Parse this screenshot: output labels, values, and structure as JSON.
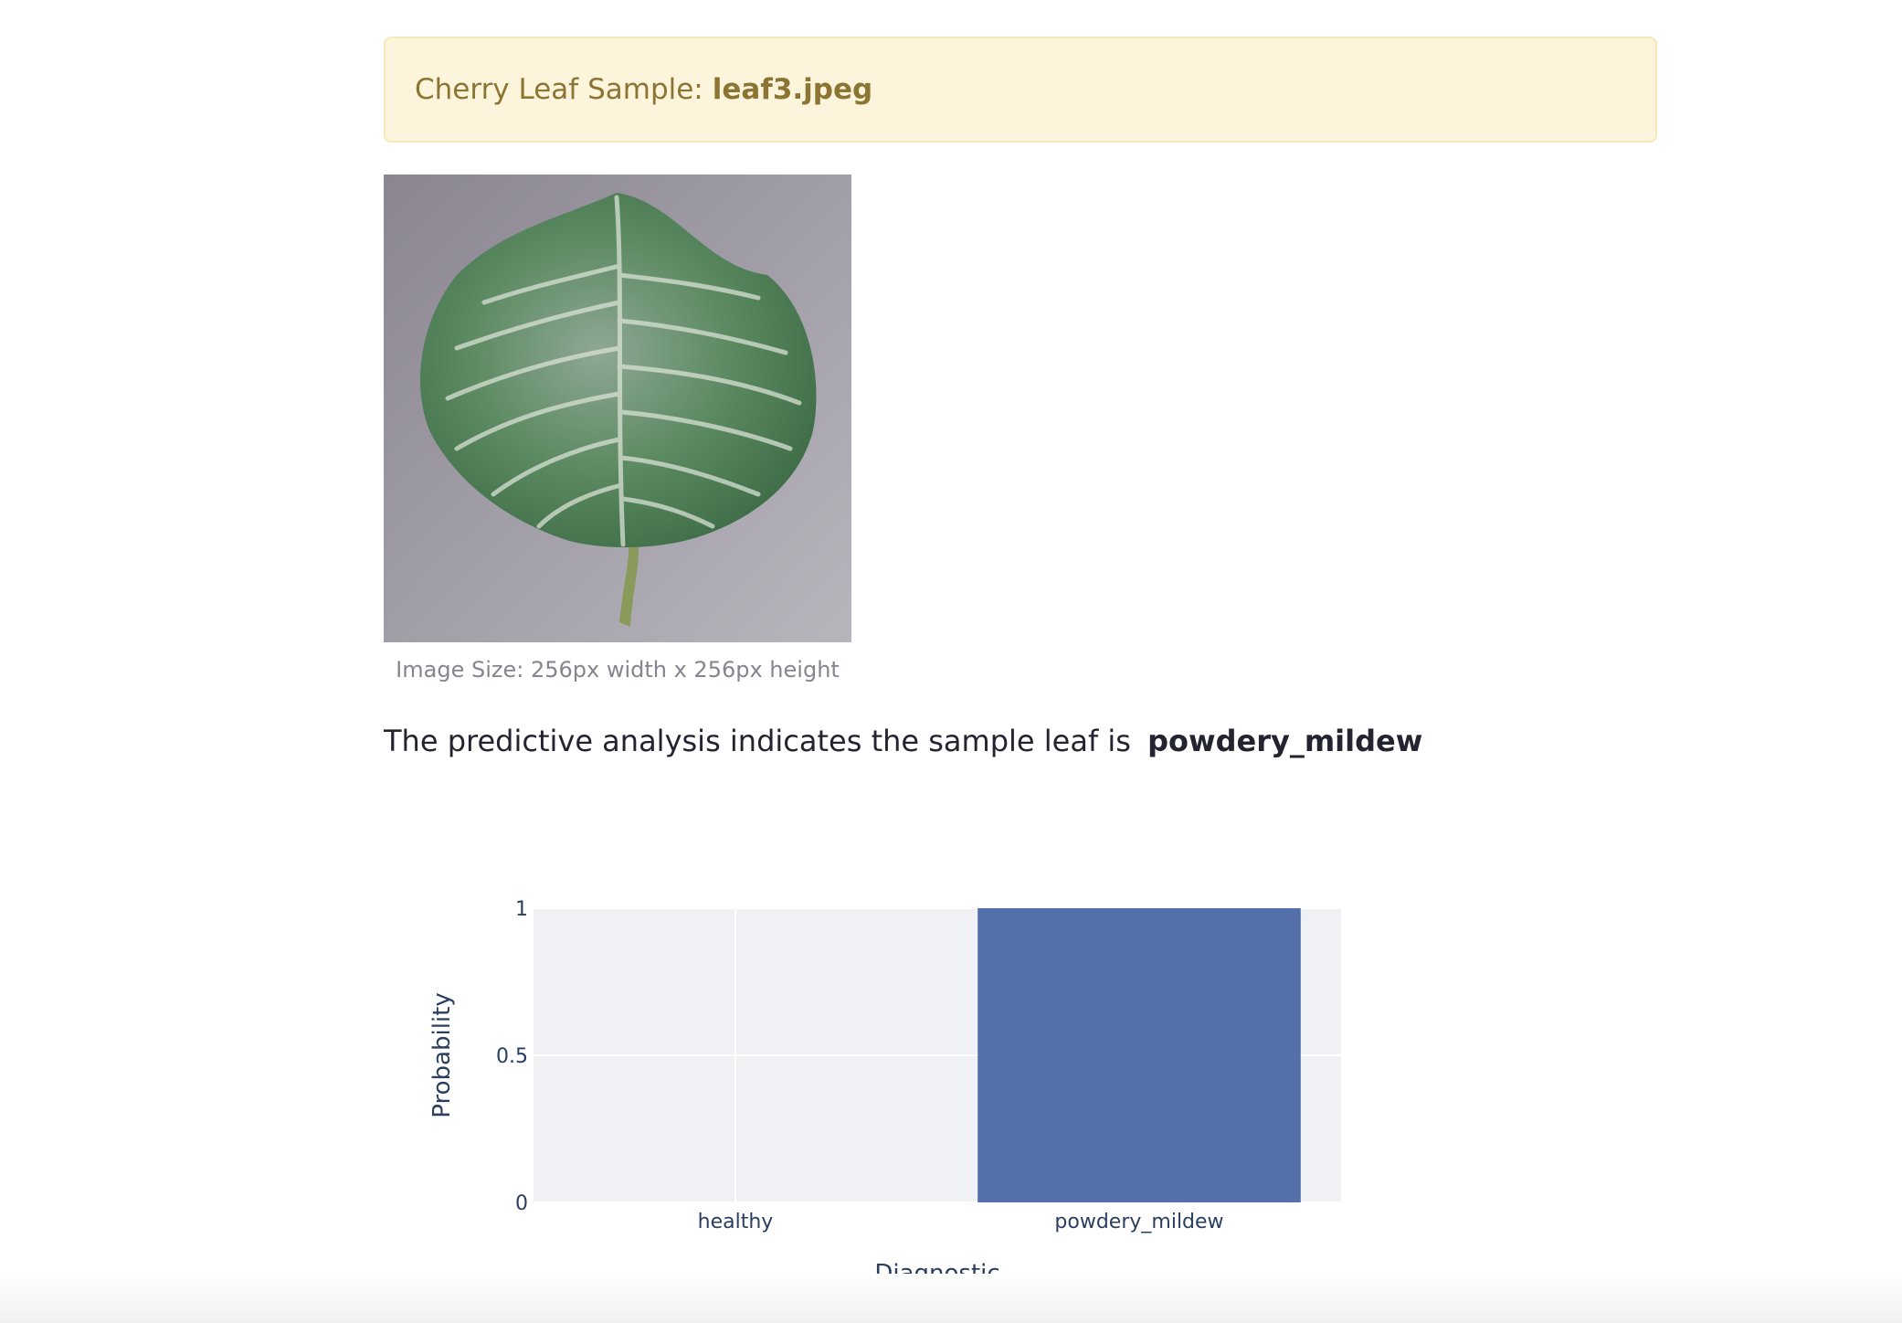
{
  "banner": {
    "prefix": "Cherry Leaf Sample:",
    "filename": "leaf3.jpeg"
  },
  "leaf_image": {
    "caption": "Image Size: 256px width x 256px height"
  },
  "prediction": {
    "sentence": "The predictive analysis indicates the sample leaf is",
    "label": "powdery_mildew"
  },
  "colors": {
    "banner_bg": "#fcf5dc",
    "banner_text": "#8c7433",
    "bar": "#5470ab",
    "plot_bg": "#f0f1f5"
  },
  "chart_data": {
    "type": "bar",
    "categories": [
      "healthy",
      "powdery_mildew"
    ],
    "values": [
      0,
      1
    ],
    "xlabel": "Diagnostic",
    "ylabel": "Probability",
    "ylim": [
      0,
      1
    ],
    "yticks": [
      "0",
      "0.5",
      "1"
    ],
    "grid": true
  }
}
